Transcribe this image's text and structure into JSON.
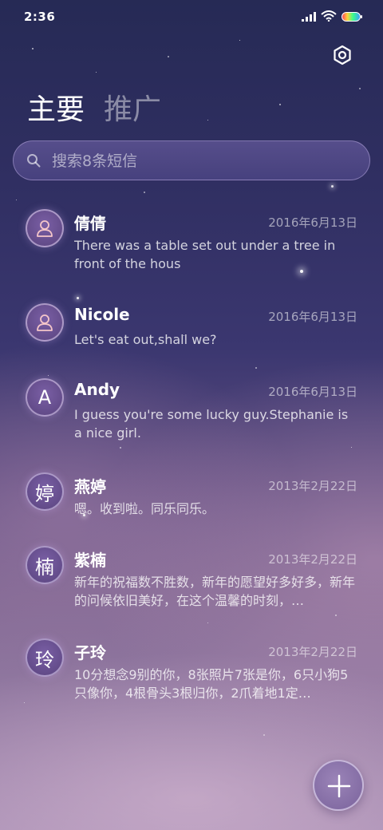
{
  "status_bar": {
    "time": "2:36"
  },
  "tabs": [
    {
      "label": "主要",
      "active": true
    },
    {
      "label": "推广",
      "active": false
    }
  ],
  "search": {
    "placeholder": "搜索8条短信"
  },
  "messages": [
    {
      "avatar_type": "icon",
      "avatar_text": "",
      "name": "倩倩",
      "date": "2016年6月13日",
      "preview": "There was a table set out under a tree in front of the hous"
    },
    {
      "avatar_type": "icon",
      "avatar_text": "",
      "name": "Nicole",
      "date": "2016年6月13日",
      "preview": "Let's eat out,shall we?"
    },
    {
      "avatar_type": "letter",
      "avatar_text": "A",
      "name": "Andy",
      "date": "2016年6月13日",
      "preview": "I guess you're some lucky guy.Stephanie is a nice girl."
    },
    {
      "avatar_type": "letter",
      "avatar_text": "婷",
      "name": "燕婷",
      "date": "2013年2月22日",
      "preview": "嗯。收到啦。同乐同乐。"
    },
    {
      "avatar_type": "letter",
      "avatar_text": "楠",
      "name": "紫楠",
      "date": "2013年2月22日",
      "preview": "新年的祝福数不胜数，新年的愿望好多好多，新年的问候依旧美好，在这个温馨的时刻，…"
    },
    {
      "avatar_type": "letter",
      "avatar_text": "玲",
      "name": "子玲",
      "date": "2013年2月22日",
      "preview": "10分想念9别的你，8张照片7张是你，6只小狗5只像你，4根骨头3根归你，2爪着地1定…"
    }
  ],
  "colors": {
    "accent": "#7a5fa5",
    "background_top": "#262a55",
    "background_bottom": "#a98fb4"
  }
}
